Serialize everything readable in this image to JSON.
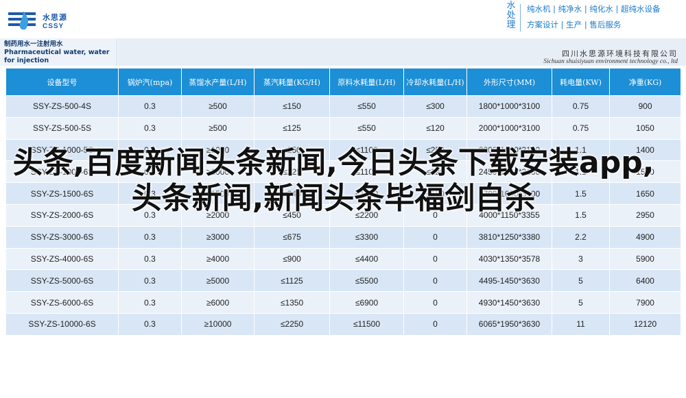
{
  "logo": {
    "cn": "水思源",
    "en": "CSSY"
  },
  "brand": {
    "vertical": "水处理"
  },
  "slogans": [
    "纯水机 | 纯净水 | 纯化水 | 超纯水设备",
    "方案设计 | 生产 | 售后服务"
  ],
  "product_title": "制药用水一注射用水 Pharmaceutical water, water for injection",
  "company": {
    "cn": "四川水思源环境科技有限公司",
    "en": "Sichuan shuisiyuan environment technology co., ltd"
  },
  "table": {
    "headers": [
      "设备型号",
      "锅炉汽(mpa)",
      "蒸馏水产量(L/H)",
      "蒸汽耗量(KG/H)",
      "原料水耗量(L/H)",
      "冷却水耗量(L/H)",
      "外形尺寸(MM)",
      "耗电量(KW)",
      "净重(KG)"
    ],
    "rows": [
      [
        "SSY-ZS-500-4S",
        "0.3",
        "≥500",
        "≤150",
        "≤550",
        "≤300",
        "1800*1000*3100",
        "0.75",
        "900"
      ],
      [
        "SSY-ZS-500-5S",
        "0.3",
        "≥500",
        "≤125",
        "≤550",
        "≤120",
        "2000*1000*3100",
        "0.75",
        "1050"
      ],
      [
        "SSY-ZS-1000-5S",
        "0.3",
        "≥1000",
        "≤250",
        "≤1100",
        "≤250",
        "2200*1000*3100",
        "1.1",
        "1400"
      ],
      [
        "SSY-ZS-1000-6S",
        "0.3",
        "≥1000",
        "≤225",
        "≤1100",
        "≤120",
        "2450*1000*3100",
        "1.1",
        "1500"
      ],
      [
        "SSY-ZS-1500-6S",
        "0.3",
        "≥1500",
        "≤340",
        "≤1650",
        "≤150",
        "2700*1000*3100",
        "1.5",
        "1650"
      ],
      [
        "SSY-ZS-2000-6S",
        "0.3",
        "≥2000",
        "≤450",
        "≤2200",
        "0",
        "4000*1150*3355",
        "1.5",
        "2950"
      ],
      [
        "SSY-ZS-3000-6S",
        "0.3",
        "≥3000",
        "≤675",
        "≤3300",
        "0",
        "3810*1250*3380",
        "2.2",
        "4900"
      ],
      [
        "SSY-ZS-4000-6S",
        "0.3",
        "≥4000",
        "≤900",
        "≤4400",
        "0",
        "4030*1350*3578",
        "3",
        "5900"
      ],
      [
        "SSY-ZS-5000-6S",
        "0.3",
        "≥5000",
        "≤1125",
        "≤5500",
        "0",
        "4495-1450*3630",
        "5",
        "6400"
      ],
      [
        "SSY-ZS-6000-6S",
        "0.3",
        "≥6000",
        "≤1350",
        "≤6900",
        "0",
        "4930*1450*3630",
        "5",
        "7900"
      ],
      [
        "SSY-ZS-10000-6S",
        "0.3",
        "≥10000",
        "≤2250",
        "≤11500",
        "0",
        "6065*1950*3630",
        "11",
        "12120"
      ]
    ]
  },
  "headline": "头条,百度新闻头条新闻,今日头条下载安装app,头条新闻,新闻头条毕福剑自杀",
  "colors": {
    "header_blue": "#1d8fd6",
    "row_a": "#d9e6f5",
    "row_b": "#eaf1f9",
    "brand": "#1e7bc8"
  }
}
